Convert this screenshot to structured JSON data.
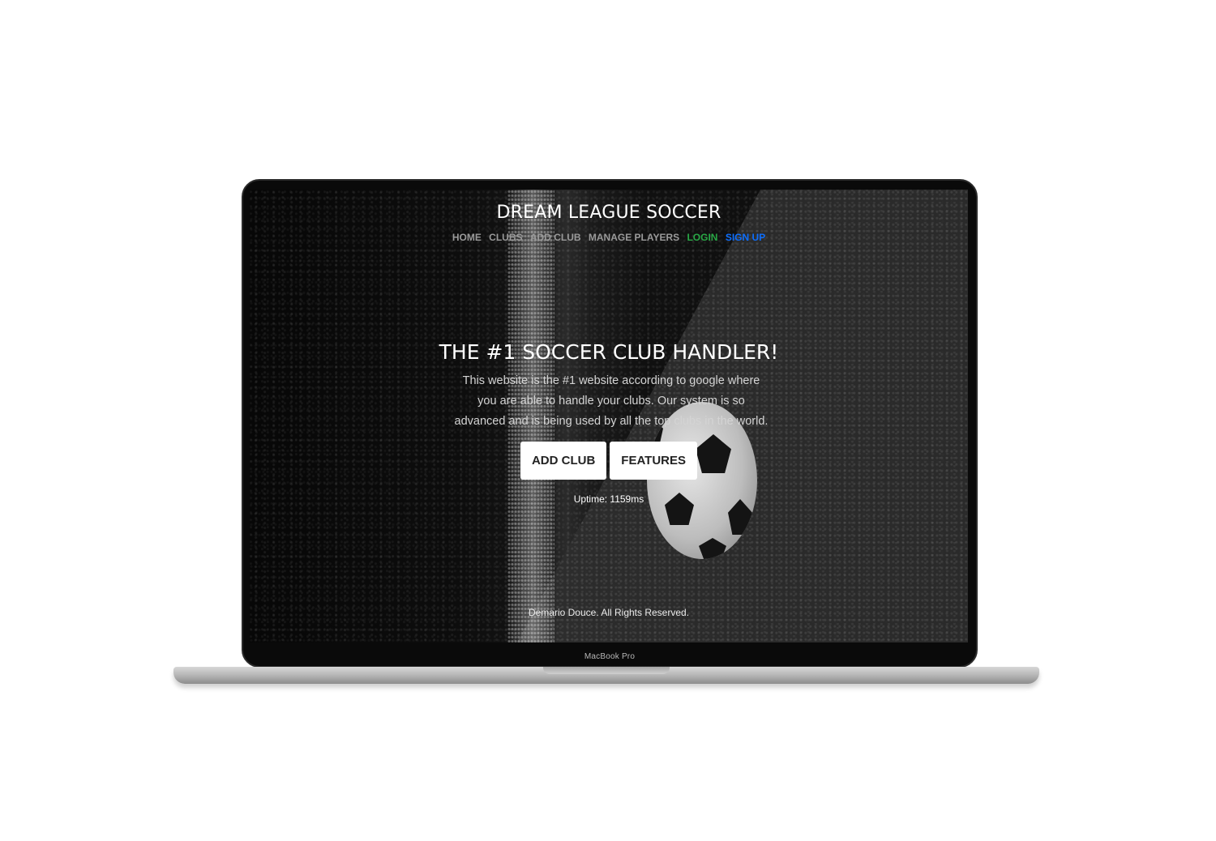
{
  "device": {
    "bezel_label": "MacBook Pro"
  },
  "site": {
    "brand": "DREAM LEAGUE SOCCER",
    "nav": [
      {
        "label": "HOME",
        "color": "#9a9a9a"
      },
      {
        "label": "CLUBS",
        "color": "#9a9a9a"
      },
      {
        "label": "ADD CLUB",
        "color": "#9a9a9a"
      },
      {
        "label": "MANAGE PLAYERS",
        "color": "#9a9a9a"
      },
      {
        "label": "LOGIN",
        "color": "#28a745"
      },
      {
        "label": "SIGN UP",
        "color": "#0d6efd"
      }
    ],
    "hero": {
      "title": "THE #1 SOCCER CLUB HANDLER!",
      "description": "This website is the #1 website according to google where you are able to handle your clubs. Our system is so advanced and is being used by all the top clubs in the world.",
      "buttons": [
        {
          "label": "ADD CLUB"
        },
        {
          "label": "FEATURES"
        }
      ],
      "uptime": "Uptime: 1159ms"
    },
    "footer": "Demario Douce. All Rights Reserved."
  }
}
